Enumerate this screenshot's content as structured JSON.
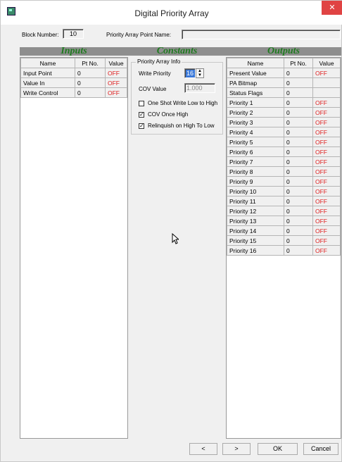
{
  "window": {
    "title": "Digital Priority Array",
    "close_glyph": "✕"
  },
  "header": {
    "block_number_label": "Block Number:",
    "block_number_value": "10",
    "pa_point_name_label": "Priority Array Point Name:",
    "pa_point_name_value": ""
  },
  "sections": {
    "inputs": "Inputs",
    "constants": "Constants",
    "outputs": "Outputs"
  },
  "inputs": {
    "columns": [
      "Name",
      "Pt No.",
      "Value"
    ],
    "rows": [
      {
        "name": "Input Point",
        "pt": "0",
        "value": "OFF"
      },
      {
        "name": "Value In",
        "pt": "0",
        "value": "OFF"
      },
      {
        "name": "Write Control",
        "pt": "0",
        "value": "OFF"
      }
    ]
  },
  "constants": {
    "group_title": "Priority Array Info",
    "write_priority_label": "Write Priority",
    "write_priority_value": "16",
    "cov_value_label": "COV Value",
    "cov_value": "1.000",
    "checkboxes": [
      {
        "label": "One Shot Write Low to High",
        "checked": false
      },
      {
        "label": "COV Once High",
        "checked": true
      },
      {
        "label": "Relinquish on High To Low",
        "checked": true
      }
    ]
  },
  "outputs": {
    "columns": [
      "Name",
      "Pt No.",
      "Value"
    ],
    "rows": [
      {
        "name": "Present Value",
        "pt": "0",
        "value": "OFF"
      },
      {
        "name": "PA Bitmap",
        "pt": "0",
        "value": ""
      },
      {
        "name": "Status Flags",
        "pt": "0",
        "value": ""
      },
      {
        "name": "Priority 1",
        "pt": "0",
        "value": "OFF"
      },
      {
        "name": "Priority 2",
        "pt": "0",
        "value": "OFF"
      },
      {
        "name": "Priority 3",
        "pt": "0",
        "value": "OFF"
      },
      {
        "name": "Priority 4",
        "pt": "0",
        "value": "OFF"
      },
      {
        "name": "Priority 5",
        "pt": "0",
        "value": "OFF"
      },
      {
        "name": "Priority 6",
        "pt": "0",
        "value": "OFF"
      },
      {
        "name": "Priority 7",
        "pt": "0",
        "value": "OFF"
      },
      {
        "name": "Priority 8",
        "pt": "0",
        "value": "OFF"
      },
      {
        "name": "Priority 9",
        "pt": "0",
        "value": "OFF"
      },
      {
        "name": "Priority 10",
        "pt": "0",
        "value": "OFF"
      },
      {
        "name": "Priority 11",
        "pt": "0",
        "value": "OFF"
      },
      {
        "name": "Priority 12",
        "pt": "0",
        "value": "OFF"
      },
      {
        "name": "Priority 13",
        "pt": "0",
        "value": "OFF"
      },
      {
        "name": "Priority 14",
        "pt": "0",
        "value": "OFF"
      },
      {
        "name": "Priority 15",
        "pt": "0",
        "value": "OFF"
      },
      {
        "name": "Priority 16",
        "pt": "0",
        "value": "OFF"
      }
    ]
  },
  "buttons": {
    "prev": "<",
    "next": ">",
    "ok": "OK",
    "cancel": "Cancel"
  },
  "colors": {
    "section_text": "#1f7a1f",
    "off_value": "#e02020",
    "close_bg": "#e04343"
  }
}
